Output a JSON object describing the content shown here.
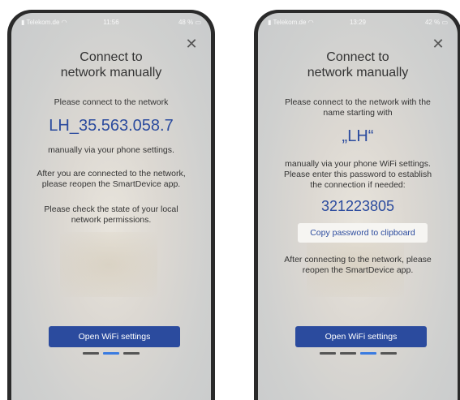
{
  "left": {
    "status": {
      "carrier": "Telekom.de",
      "time": "11:56",
      "battery": "48 %"
    },
    "title": "Connect to\nnetwork manually",
    "instruction": "Please connect to the network",
    "network_name": "LH_35.563.058.7",
    "settings_hint": "manually via your phone settings.",
    "reopen_hint": "After you are connected to the network,\nplease reopen the SmartDevice app.",
    "permissions_hint": "Please check the state of your local\nnetwork permissions.",
    "button_label": "Open WiFi settings",
    "pagination": {
      "count": 3,
      "active": 2
    }
  },
  "right": {
    "status": {
      "carrier": "Telekom.de",
      "time": "13:29",
      "battery": "42 %"
    },
    "title": "Connect to\nnetwork manually",
    "instruction": "Please connect to the network with the\nname starting with",
    "network_name": "„LH“",
    "password_hint": "manually via your phone WiFi settings.\nPlease enter this password to establish\nthe connection if needed:",
    "password": "321223805",
    "copy_label": "Copy password to clipboard",
    "reopen_hint": "After connecting to the network, please\nreopen the SmartDevice app.",
    "button_label": "Open WiFi settings",
    "pagination": {
      "count": 4,
      "active": 3
    }
  },
  "icons": {
    "close": "close-icon",
    "wifi": "wifi-icon",
    "signal": "signal-icon",
    "battery": "battery-icon"
  },
  "colors": {
    "accent": "#2b4b9e",
    "active_dot": "#3a7be0"
  }
}
